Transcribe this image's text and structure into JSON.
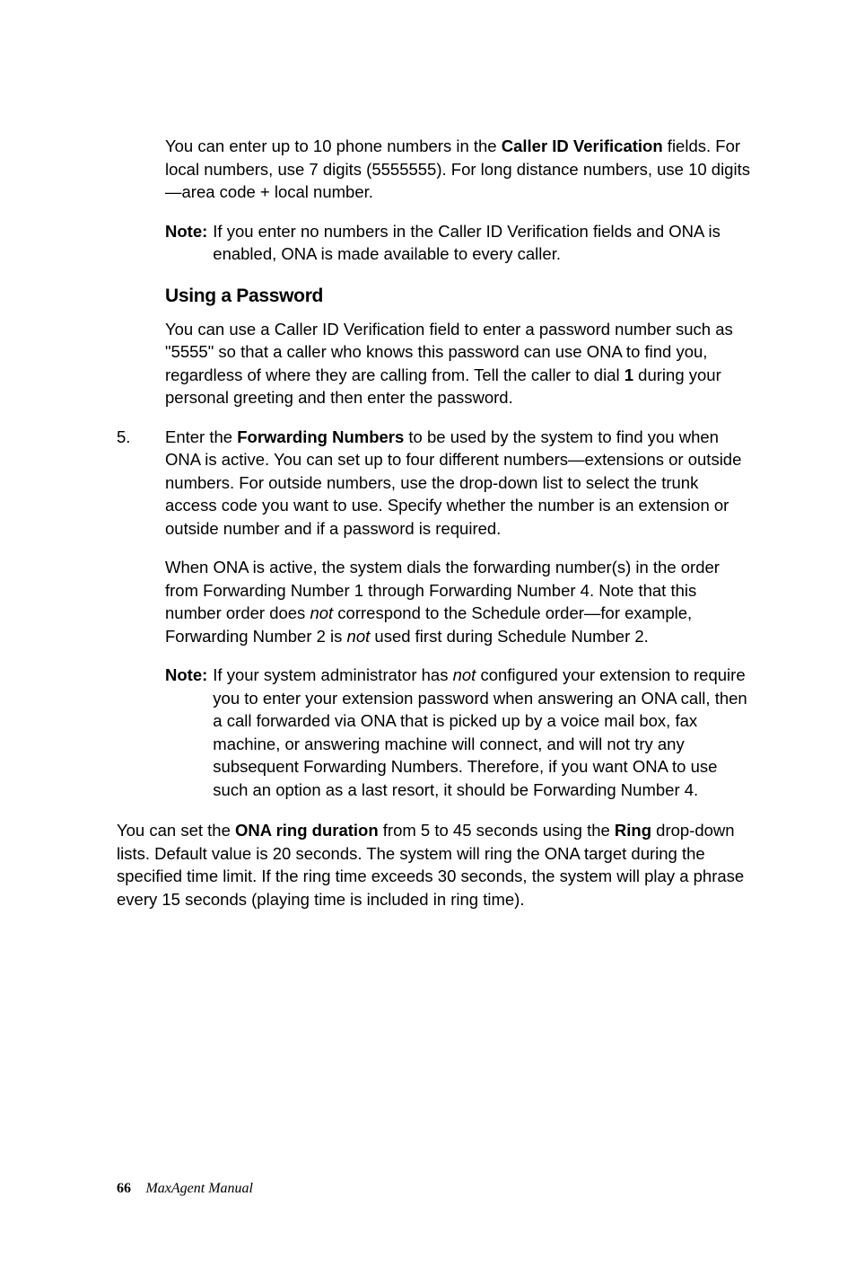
{
  "para1_a": "You can enter up to 10 phone numbers in the ",
  "para1_b": "Caller ID Verification",
  "para1_c": " fields. For local numbers, use 7 digits (5555555). For long distance numbers, use 10 digits—area code + local number.",
  "note1_label": "Note:",
  "note1_text": "If you enter no numbers in the Caller ID Verification fields and ONA is enabled, ONA is made available to every caller.",
  "subhead1": "Using a Password",
  "para2_a": "You can use a Caller ID Verification field to enter a password number such as \"5555\" so that a caller who knows this password can use ONA to find you, regardless of where they are calling from. Tell the caller to dial ",
  "para2_b": "1",
  "para2_c": " during your personal greeting and then enter the password.",
  "item5_num": "5.",
  "item5_a": "Enter the ",
  "item5_b": "Forwarding Numbers",
  "item5_c": " to be used by the system to find you when ONA is active. You can set up to four different numbers—extensions or outside numbers. For outside numbers, use the drop-down list to select the trunk access code you want to use. Specify whether the number is an extension or outside number and if a password is required.",
  "para3_a": "When ONA is active, the system dials the forwarding number(s) in the order from Forwarding Number 1 through Forwarding Number 4. Note that this number order does ",
  "para3_b": "not",
  "para3_c": " correspond to the Schedule order—for example, Forwarding Number 2 is ",
  "para3_d": "not",
  "para3_e": " used first during Schedule Number 2.",
  "note2_label": "Note:",
  "note2_a": "If your system administrator has ",
  "note2_b": "not",
  "note2_c": " configured your extension to require you to enter your extension password when answering an ONA call, then a call forwarded via ONA that is picked up by a voice mail box, fax machine, or answering machine will connect, and will not try any subsequent Forwarding Numbers. Therefore, if you want ONA to use such an option as a last resort, it should be Forwarding Number 4.",
  "para4_a": "You can set the ",
  "para4_b": "ONA ring duration",
  "para4_c": " from 5 to 45 seconds using the ",
  "para4_d": "Ring",
  "para4_e": " drop-down lists. Default value is 20 seconds. The system will ring the ONA target during the specified time limit. If the ring time exceeds 30 seconds, the system will play a phrase every 15 seconds (playing time is included in ring time).",
  "footer_page": "66",
  "footer_title": "MaxAgent Manual"
}
